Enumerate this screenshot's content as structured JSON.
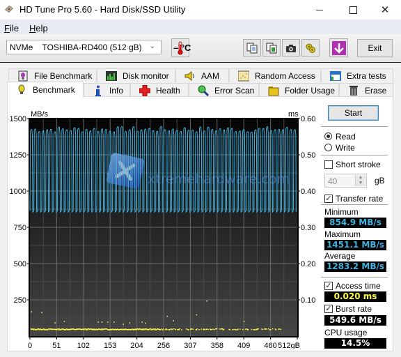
{
  "window": {
    "title": "HD Tune Pro 5.60 - Hard Disk/SSD Utility",
    "controls": {
      "minimize": "—",
      "maximize": "☐",
      "close": "✕"
    }
  },
  "menu": {
    "items": [
      {
        "label": "File",
        "accel": "F",
        "rest": "ile"
      },
      {
        "label": "Help",
        "accel": "H",
        "rest": "elp"
      }
    ]
  },
  "toolbar": {
    "drive_select": {
      "value": "NVMe    TOSHIBA-RD400 (512 gB)"
    },
    "temperature": "– °C",
    "icons": [
      "copy-text-icon",
      "copy-screenshot-icon",
      "camera-icon",
      "options-icon",
      "save-download-icon"
    ],
    "exit_label": "Exit"
  },
  "tabs": {
    "row1": [
      {
        "label": "File Benchmark",
        "icon": "file-benchmark-icon"
      },
      {
        "label": "Disk monitor",
        "icon": "disk-monitor-icon"
      },
      {
        "label": "AAM",
        "icon": "speaker-icon"
      },
      {
        "label": "Random Access",
        "icon": "random-access-icon"
      },
      {
        "label": "Extra tests",
        "icon": "extra-tests-icon"
      }
    ],
    "row2": [
      {
        "label": "Benchmark",
        "icon": "lightbulb-icon",
        "active": true
      },
      {
        "label": "Info",
        "icon": "info-icon"
      },
      {
        "label": "Health",
        "icon": "health-cross-icon"
      },
      {
        "label": "Error Scan",
        "icon": "magnifier-icon"
      },
      {
        "label": "Folder Usage",
        "icon": "folder-icon"
      },
      {
        "label": "Erase",
        "icon": "trash-icon"
      }
    ]
  },
  "benchmark": {
    "start_label": "Start",
    "mode": {
      "options": [
        "Read",
        "Write"
      ],
      "selected": "Read"
    },
    "short_stroke": {
      "label": "Short stroke",
      "checked": false,
      "value": "40",
      "unit": "gB"
    },
    "transfer_rate": {
      "label": "Transfer rate",
      "checked": true
    },
    "minimum": {
      "label": "Minimum",
      "value": "854.9 MB/s"
    },
    "maximum": {
      "label": "Maximum",
      "value": "1451.1 MB/s"
    },
    "average": {
      "label": "Average",
      "value": "1283.2 MB/s"
    },
    "access_time": {
      "label": "Access time",
      "checked": true,
      "value": "0.020 ms"
    },
    "burst_rate": {
      "label": "Burst rate",
      "checked": true,
      "value": "549.6 MB/s"
    },
    "cpu_usage": {
      "label": "CPU usage",
      "value": "14.5%"
    },
    "colors": {
      "transfer": "#3db3e3",
      "access": "#ffff40",
      "readout_text": "#3db3e3"
    }
  },
  "watermark": "xtremehardware.com",
  "chart_data": {
    "type": "line",
    "title": "",
    "xlabel": "gB",
    "ylabel": "MB/s",
    "y2label": "ms",
    "xlim": [
      0,
      512
    ],
    "ylim": [
      0,
      1500
    ],
    "y2lim": [
      0,
      0.6
    ],
    "x_ticks": [
      "0",
      "51",
      "102",
      "153",
      "204",
      "256",
      "307",
      "358",
      "409",
      "460",
      "512gB"
    ],
    "y_ticks": [
      "250",
      "500",
      "750",
      "1000",
      "1250",
      "1500"
    ],
    "y2_ticks": [
      "0.10",
      "0.20",
      "0.30",
      "0.40",
      "0.50",
      "0.60"
    ],
    "grid": true,
    "series": [
      {
        "name": "Transfer rate (MB/s)",
        "pattern": "oscillating",
        "peak": 1430,
        "trough": 855,
        "min": 854.9,
        "max": 1451.1,
        "average": 1283.2,
        "cycles": 68
      },
      {
        "name": "Access time (ms)",
        "type": "scatter",
        "baseline": 0.02,
        "outliers": [
          [
            2,
            0.068
          ],
          [
            22,
            0.066
          ],
          [
            47,
            0.038
          ],
          [
            65,
            0.042
          ],
          [
            130,
            0.04
          ],
          [
            137,
            0.04
          ],
          [
            148,
            0.04
          ],
          [
            160,
            0.04
          ],
          [
            178,
            0.034
          ],
          [
            190,
            0.038
          ],
          [
            214,
            0.04
          ],
          [
            220,
            0.037
          ],
          [
            262,
            0.056
          ],
          [
            274,
            0.044
          ],
          [
            318,
            0.06
          ],
          [
            338,
            0.098
          ],
          [
            409,
            0.042
          ]
        ]
      }
    ]
  }
}
